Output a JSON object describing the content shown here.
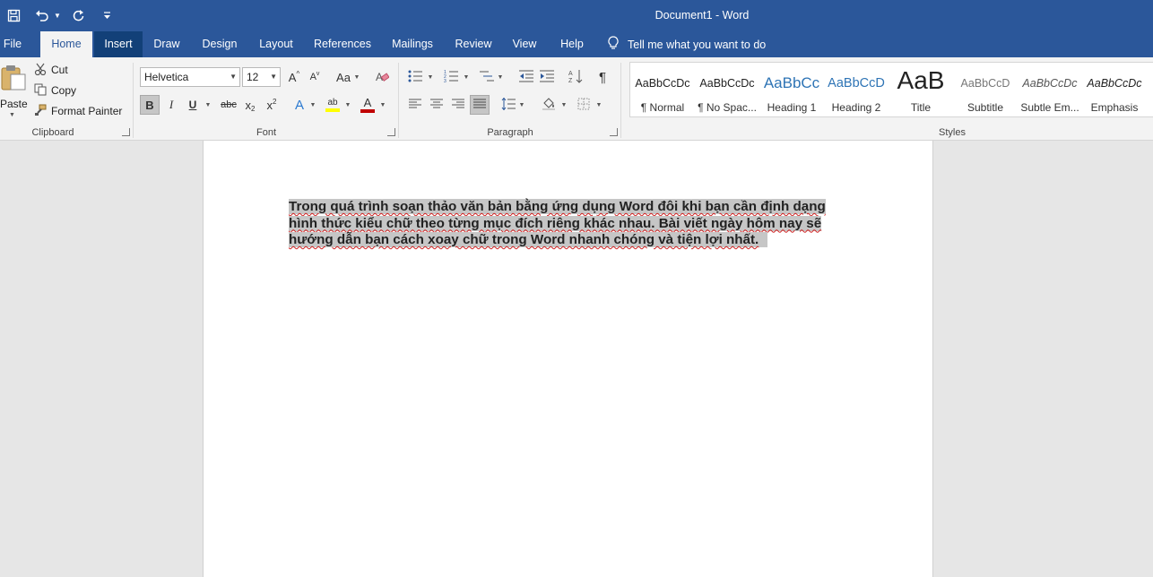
{
  "window": {
    "title": "Document1  -  Word"
  },
  "qat": {
    "save_icon": "save-icon",
    "undo_icon": "undo-icon",
    "redo_icon": "redo-icon",
    "customize_icon": "customize-qat-icon"
  },
  "tabs": [
    {
      "label": "File"
    },
    {
      "label": "Home"
    },
    {
      "label": "Insert"
    },
    {
      "label": "Draw"
    },
    {
      "label": "Design"
    },
    {
      "label": "Layout"
    },
    {
      "label": "References"
    },
    {
      "label": "Mailings"
    },
    {
      "label": "Review"
    },
    {
      "label": "View"
    },
    {
      "label": "Help"
    }
  ],
  "tellme": {
    "label": "Tell me what you want to do",
    "icon": "lightbulb-icon"
  },
  "clipboard": {
    "label": "Clipboard",
    "paste": "Paste",
    "cut": "Cut",
    "copy": "Copy",
    "format_painter": "Format Painter"
  },
  "font": {
    "label": "Font",
    "family": "Helvetica",
    "size": "12",
    "grow": "A",
    "shrink": "A",
    "change_case": "Aa",
    "bold": "B",
    "italic": "I",
    "underline": "U",
    "strike": "abc",
    "subscript": "x",
    "superscript": "x",
    "effects": "A",
    "highlight": "ab",
    "color": "A",
    "color_hex": "#c00000",
    "highlight_hex": "#ffff00"
  },
  "paragraph": {
    "label": "Paragraph",
    "pilcrow": "¶"
  },
  "styles": {
    "label": "Styles",
    "items": [
      {
        "preview": "AaBbCcDc",
        "name": "¶ Normal"
      },
      {
        "preview": "AaBbCcDc",
        "name": "¶ No Spac..."
      },
      {
        "preview": "AaBbCc",
        "name": "Heading 1"
      },
      {
        "preview": "AaBbCcD",
        "name": "Heading 2"
      },
      {
        "preview": "AaB",
        "name": "Title"
      },
      {
        "preview": "AaBbCcD",
        "name": "Subtitle"
      },
      {
        "preview": "AaBbCcDc",
        "name": "Subtle Em..."
      },
      {
        "preview": "AaBbCcDc",
        "name": "Emphasis"
      }
    ]
  },
  "document": {
    "paragraph": "Trong quá trình soạn thảo văn bản bằng ứng dụng Word đôi khi bạn cần định dạng hình thức kiểu chữ theo từng mục đích riêng khác nhau. Bài viết ngày hôm nay sẽ hướng dẫn bạn cách xoay chữ trong Word nhanh chóng và tiện lợi nhất."
  }
}
